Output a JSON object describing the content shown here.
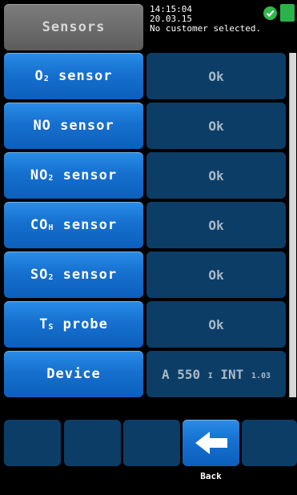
{
  "header": {
    "title": "Sensors",
    "time": "14:15:04",
    "date": "20.03.15",
    "customer_status": "No customer selected.",
    "status_icons": [
      "check-icon",
      "battery-icon"
    ]
  },
  "rows": [
    {
      "label_main": "O",
      "label_sub": "2",
      "label_rest": " sensor",
      "value": "Ok"
    },
    {
      "label_main": "NO sensor",
      "label_sub": "",
      "label_rest": "",
      "value": "Ok"
    },
    {
      "label_main": "NO",
      "label_sub": "2",
      "label_rest": " sensor",
      "value": "Ok"
    },
    {
      "label_main": "CO",
      "label_sub": "H",
      "label_rest": " sensor",
      "value": "Ok"
    },
    {
      "label_main": "SO",
      "label_sub": "2",
      "label_rest": " sensor",
      "value": "Ok"
    },
    {
      "label_main": "T",
      "label_sub": "S",
      "label_rest": " probe",
      "value": "Ok"
    },
    {
      "label_main": "Device",
      "label_sub": "",
      "label_rest": "",
      "value_main": "A 550 ",
      "value_sub1": "I",
      "value_mid": " INT ",
      "value_sub2": "1.03"
    }
  ],
  "toolbar": {
    "back_label": "Back",
    "back_icon": "arrow-left-icon"
  },
  "colors": {
    "button_blue": "#1670cf",
    "value_panel": "#0c3d66",
    "title_gray": "#6b6b6b",
    "ok_green": "#2fb84a"
  }
}
